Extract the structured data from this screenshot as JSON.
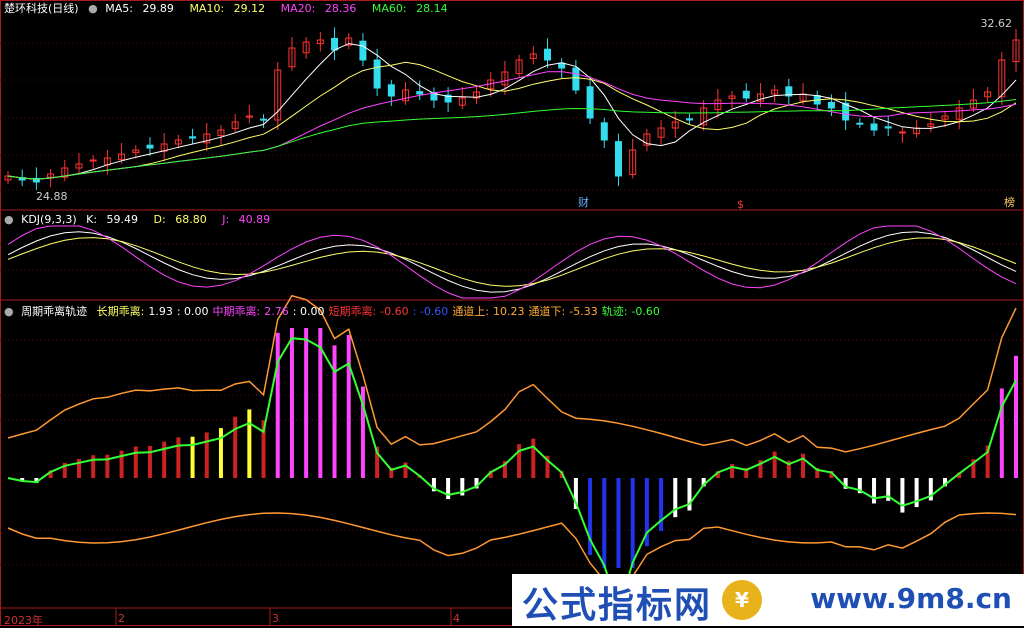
{
  "panel1": {
    "title": "楚环科技(日线)",
    "ma": [
      {
        "label": "MA5:",
        "value": "29.89",
        "color": "#ffffff"
      },
      {
        "label": "MA10:",
        "value": "29.12",
        "color": "#ffff66"
      },
      {
        "label": "MA20:",
        "value": "28.36",
        "color": "#ff44ff"
      },
      {
        "label": "MA60:",
        "value": "28.14",
        "color": "#33ff33"
      }
    ],
    "high_label": "32.62",
    "low_label": "24.88",
    "markers": [
      "财",
      "$",
      "榜"
    ]
  },
  "panel2": {
    "title": "KDJ(9,3,3)",
    "k_label": "K:",
    "k": "59.49",
    "d_label": "D:",
    "d": "68.80",
    "j_label": "J:",
    "j": "40.89"
  },
  "panel3": {
    "title": "周期乖离轨迹",
    "items": [
      {
        "text": "长期乖离:",
        "color": "#ffff66"
      },
      {
        "text": "1.93",
        "color": "#ffffff"
      },
      {
        "text": ": 0.00",
        "color": "#ffffff"
      },
      {
        "text": "中期乖离:",
        "color": "#ff44ff"
      },
      {
        "text": "2.76",
        "color": "#ff44ff"
      },
      {
        "text": ": 0.00",
        "color": "#ffffff"
      },
      {
        "text": "短期乖离:",
        "color": "#ff3333"
      },
      {
        "text": "-0.60",
        "color": "#ff3333"
      },
      {
        "text": ": -0.60",
        "color": "#3355ff"
      },
      {
        "text": "通道上:",
        "color": "#ffaa33"
      },
      {
        "text": "10.23",
        "color": "#ffaa33"
      },
      {
        "text": "通道下:",
        "color": "#ffaa33"
      },
      {
        "text": "-5.33",
        "color": "#ffaa33"
      },
      {
        "text": "轨迹:",
        "color": "#33ff33"
      },
      {
        "text": "-0.60",
        "color": "#33ff33"
      }
    ]
  },
  "dates": [
    "2023年",
    "2",
    "3",
    "4"
  ],
  "watermark": {
    "left": "公式指标网",
    "right": "www.9m8.cn"
  },
  "chart_data": [
    {
      "type": "candlestick",
      "title": "楚环科技(日线)",
      "ylim": [
        24,
        33
      ],
      "close": [
        25.2,
        25.0,
        24.9,
        25.3,
        25.6,
        25.8,
        26.0,
        26.1,
        26.3,
        26.5,
        26.6,
        26.8,
        27.0,
        27.1,
        27.3,
        27.5,
        27.9,
        28.2,
        28.0,
        30.5,
        31.6,
        31.9,
        32.0,
        31.5,
        32.1,
        31.0,
        29.6,
        29.2,
        29.5,
        29.3,
        29.0,
        28.9,
        29.1,
        29.4,
        30.0,
        30.4,
        31.0,
        31.3,
        31.0,
        30.6,
        29.5,
        28.1,
        27.0,
        25.2,
        26.5,
        27.3,
        27.6,
        27.9,
        28.0,
        28.6,
        29.0,
        29.2,
        29.1,
        29.3,
        29.5,
        29.2,
        29.3,
        28.8,
        28.6,
        28.0,
        27.8,
        27.5,
        27.6,
        27.4,
        27.6,
        27.8,
        28.2,
        28.6,
        29.0,
        29.4,
        31.0,
        32.0
      ]
    },
    {
      "type": "line",
      "title": "KDJ(9,3,3)",
      "series": [
        {
          "name": "K",
          "values": [
            59.49
          ]
        },
        {
          "name": "D",
          "values": [
            68.8
          ]
        },
        {
          "name": "J",
          "values": [
            40.89
          ]
        }
      ]
    },
    {
      "type": "bar",
      "title": "周期乖离轨迹",
      "series": [
        {
          "name": "长期乖离",
          "values": [
            1.93
          ]
        },
        {
          "name": "中期乖离",
          "values": [
            2.76
          ]
        },
        {
          "name": "短期乖离",
          "values": [
            -0.6
          ]
        },
        {
          "name": "通道上",
          "values": [
            10.23
          ]
        },
        {
          "name": "通道下",
          "values": [
            -5.33
          ]
        },
        {
          "name": "轨迹",
          "values": [
            -0.6
          ]
        }
      ]
    }
  ]
}
